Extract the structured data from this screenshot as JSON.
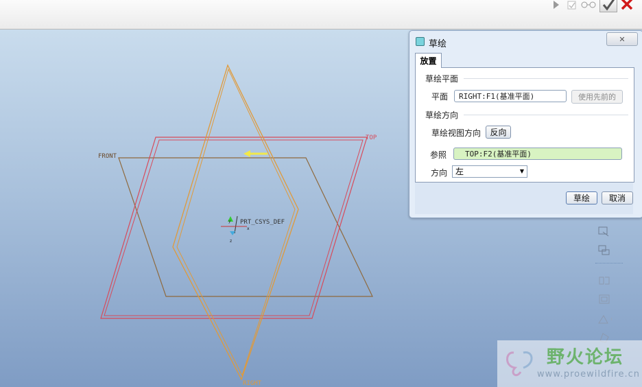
{
  "toolbar": {
    "icons": [
      "play-icon",
      "checkbox-icon",
      "glasses-icon",
      "check-icon",
      "close-icon"
    ]
  },
  "dialog": {
    "title": "草绘",
    "close_glyph": "✕",
    "tab": "放置",
    "section_plane": "草绘平面",
    "plane_label": "平面",
    "plane_value": "RIGHT:F1(基准平面)",
    "use_previous": "使用先前的",
    "section_orient": "草绘方向",
    "view_dir_label": "草绘视图方向",
    "flip_button": "反向",
    "ref_label": "参照",
    "ref_value": "TOP:F2(基准平面)",
    "dir_label": "方向",
    "dir_value": "左",
    "sketch_button": "草绘",
    "cancel_button": "取消"
  },
  "model": {
    "front_label": "FRONT",
    "top_label": "TOP",
    "right_label": "RIGHT",
    "csys_label": "PRT_CSYS_DEF",
    "axis_y": "y",
    "axis_z": "z",
    "axis_x": "x"
  },
  "colors": {
    "datum_plane_front": "#8f6a3e",
    "datum_plane_top": "#d84a5a",
    "datum_plane_right": "#e09a3a",
    "arrow": "#f2e84a",
    "highlight_field": "#d8f3c2"
  },
  "watermark": {
    "title": "野火论坛",
    "url": "www.proewildfire.cn"
  }
}
